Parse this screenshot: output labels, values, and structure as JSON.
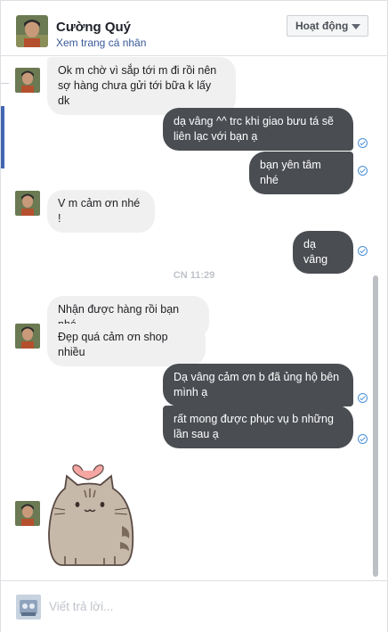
{
  "header": {
    "name": "Cường Quý",
    "profile_link": "Xem trang cá nhân",
    "status_button": "Hoạt động"
  },
  "messages": [
    {
      "id": "m1",
      "direction": "in",
      "lines": [
        "Ok m chờ vì sắp tới m đi rồi nên",
        "sợ hàng chưa gửi tới bữa k lấy dk"
      ]
    },
    {
      "id": "m2",
      "direction": "out",
      "lines": [
        "dạ vâng ^^ trc khi giao bưu tá sẽ",
        "liên lạc với bạn ạ"
      ],
      "seen": true
    },
    {
      "id": "m3",
      "direction": "out",
      "lines": [
        "bạn yên tâm nhé"
      ],
      "seen": true
    },
    {
      "id": "m4",
      "direction": "in",
      "lines": [
        "V m cảm ơn nhé !"
      ]
    },
    {
      "id": "m5",
      "direction": "out",
      "lines": [
        "dạ vâng"
      ],
      "seen": true
    },
    {
      "id": "m6",
      "direction": "in",
      "lines": [
        "Nhận được hàng rồi bạn nhé"
      ]
    },
    {
      "id": "m7",
      "direction": "in",
      "lines": [
        "Đẹp quá cảm ơn shop nhiều"
      ]
    },
    {
      "id": "m8",
      "direction": "out",
      "lines": [
        "Dạ vâng cảm ơn b đã ủng hộ bên",
        "mình ạ"
      ],
      "seen": true
    },
    {
      "id": "m9",
      "direction": "out",
      "lines": [
        "rất mong được phục vụ b những",
        "lần sau ạ"
      ],
      "seen": true
    }
  ],
  "time_separator": "CN 11:29",
  "sticker": {
    "icon": "pusheen-cat-heart-sticker"
  },
  "composer": {
    "placeholder": "Viết trả lời..."
  },
  "colors": {
    "outgoing_bubble": "#4a4d52",
    "incoming_bubble": "#f1f0f0",
    "link": "#385898",
    "seen_check": "#4a90d9"
  }
}
